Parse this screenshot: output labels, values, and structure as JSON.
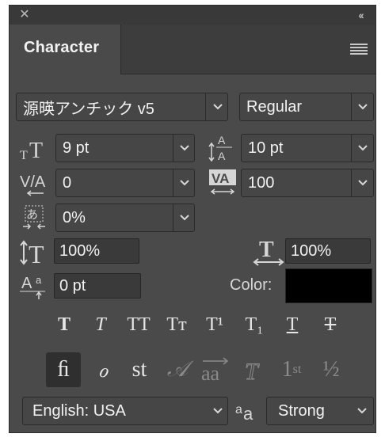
{
  "panel": {
    "tab_label": "Character",
    "close_glyph": "✕",
    "collapse_glyph": "‹‹"
  },
  "font": {
    "family": "源暎アンチック v5",
    "style": "Regular"
  },
  "metrics": {
    "size": "9 pt",
    "leading": "10 pt",
    "kerning": "0",
    "tracking": "100",
    "tsume": "0%",
    "vertical_scale": "100%",
    "horizontal_scale": "100%",
    "baseline_shift": "0 pt",
    "color_label": "Color:",
    "color_value": "#000000"
  },
  "type_styles": [
    "T",
    "T",
    "TT",
    "Tт",
    "T¹",
    "T₁",
    "T",
    "T"
  ],
  "opentype": {
    "ligature": "ﬁ",
    "swash": "ℴ",
    "discretionary": "st",
    "stylistic": "𝒜",
    "titling": "aa",
    "ordinal_sup": "st",
    "ordinal": "1",
    "fraction": "½"
  },
  "bottom": {
    "language": "English: USA",
    "antialias_icon_label": "a",
    "antialias_sub": "a",
    "antialias": "Strong"
  }
}
